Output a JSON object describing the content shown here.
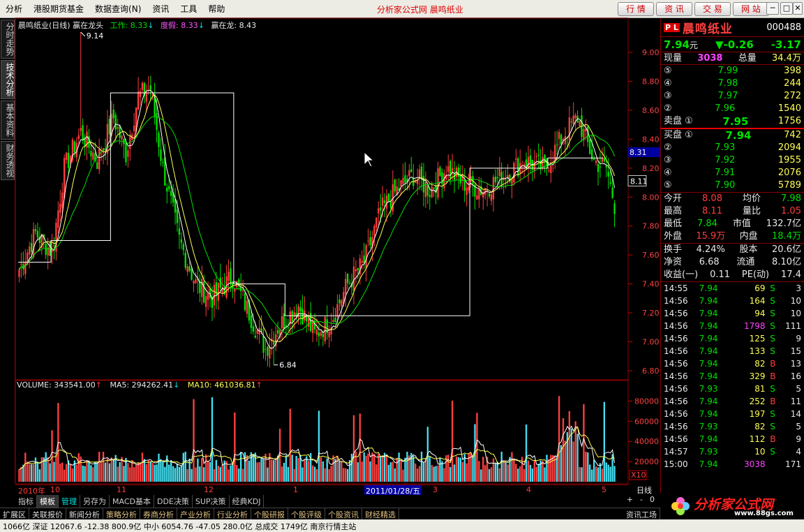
{
  "menu": {
    "items": [
      "分析",
      "港股期货基金",
      "数据查询(N)",
      "资讯",
      "工具",
      "帮助"
    ],
    "center_title": "分析家公式网  晨鸣纸业",
    "quick_buttons": [
      "行 情",
      "资 讯",
      "交 易",
      "网 站"
    ]
  },
  "left_tabs": [
    "分时走势",
    "技术分析",
    "基本资料",
    "财务透视"
  ],
  "kline_header": {
    "title": "晨鸣纸业(日线) 赢在龙头",
    "work_label": "工作: 8.33",
    "dujia_label": "度假: 8.33",
    "yingzailong_label": "赢在龙: 8.43"
  },
  "price_axis": [
    "9.00",
    "8.80",
    "8.60",
    "8.40",
    "8.20",
    "8.00",
    "7.80",
    "7.60",
    "7.40",
    "7.20",
    "7.00",
    "6.80"
  ],
  "price_marker": "8.31",
  "last_marker": "8.11",
  "high_label": "9.14",
  "low_label": "6.84",
  "volume_header": {
    "volume": "VOLUME: 343541.00",
    "ma5": "MA5: 294262.41",
    "ma10": "MA10: 461036.81"
  },
  "volume_axis": [
    "80000",
    "60000",
    "40000",
    "20000"
  ],
  "volume_unit": "X10",
  "date_labels": [
    "2010年",
    "10",
    "11",
    "12",
    "1",
    "2011/01/28/五",
    "3",
    "4",
    "5"
  ],
  "period": "日线",
  "bottom_tabs": [
    "指标",
    "模板",
    "管理",
    "另存为",
    "MACD基本",
    "DDE决策",
    "SUP决策",
    "经典KDJ"
  ],
  "bottom_ctrls": [
    "+",
    "-",
    "0"
  ],
  "sub_tabs": [
    "扩展区",
    "关联报价",
    "新闻分析",
    "策略分析",
    "券商分析",
    "产业分析",
    "行业分析",
    "个股研报",
    "个股评级",
    "个股资讯",
    "财经精选"
  ],
  "sub_right": "资讯工场",
  "status_text": "1066亿  深证 12067.6  -12.38  800.9亿  中小 6054.76  -47.05  280.0亿  总成交 1749亿  南京行情主站",
  "stock": {
    "pl": "P L",
    "name": "晨鸣纸业",
    "code": "000488",
    "price": "7.94",
    "price_unit": "元",
    "change": "▼-0.26",
    "pct": "-3.17",
    "xianliang_label": "现量",
    "xianliang": "3038",
    "zongliang_label": "总量",
    "zongliang": "34.4万"
  },
  "asks": [
    {
      "lvl": "⑤",
      "price": "7.99",
      "vol": "398"
    },
    {
      "lvl": "④",
      "price": "7.98",
      "vol": "244"
    },
    {
      "lvl": "③",
      "price": "7.97",
      "vol": "272"
    },
    {
      "lvl": "②",
      "price": "7.96",
      "vol": "1540"
    },
    {
      "lvl": "卖盘 ①",
      "price": "7.95",
      "vol": "1756"
    }
  ],
  "bids": [
    {
      "lvl": "买盘 ①",
      "price": "7.94",
      "vol": "742"
    },
    {
      "lvl": "②",
      "price": "7.93",
      "vol": "2094"
    },
    {
      "lvl": "③",
      "price": "7.92",
      "vol": "1955"
    },
    {
      "lvl": "④",
      "price": "7.91",
      "vol": "2076"
    },
    {
      "lvl": "⑤",
      "price": "7.90",
      "vol": "5789"
    }
  ],
  "stats": [
    {
      "l1": "今开",
      "v1": "8.08",
      "l2": "均价",
      "v2": "7.98"
    },
    {
      "l1": "最高",
      "v1": "8.11",
      "l2": "量比",
      "v2": "1.05"
    },
    {
      "l1": "最低",
      "v1": "7.84",
      "l2": "市值",
      "v2": "132.7亿"
    },
    {
      "l1": "外盘",
      "v1": "15.9万",
      "l2": "内盘",
      "v2": "18.4万"
    }
  ],
  "fin": [
    {
      "l1": "换手",
      "v1": "4.24%",
      "l2": "股本",
      "v2": "20.6亿"
    },
    {
      "l1": "净资",
      "v1": "6.68",
      "l2": "流通",
      "v2": "8.10亿"
    },
    {
      "l1": "收益(一)",
      "v1": "0.11",
      "l2": "PE(动)",
      "v2": "17.4"
    }
  ],
  "ticks": [
    {
      "t": "14:55",
      "p": "7.94",
      "v": "69",
      "s": "S",
      "n": "3"
    },
    {
      "t": "14:56",
      "p": "7.94",
      "v": "164",
      "s": "S",
      "n": "10"
    },
    {
      "t": "14:56",
      "p": "7.94",
      "v": "94",
      "s": "S",
      "n": "10"
    },
    {
      "t": "14:56",
      "p": "7.94",
      "v": "1798",
      "s": "S",
      "n": "111"
    },
    {
      "t": "14:56",
      "p": "7.94",
      "v": "125",
      "s": "S",
      "n": "9"
    },
    {
      "t": "14:56",
      "p": "7.94",
      "v": "133",
      "s": "S",
      "n": "15"
    },
    {
      "t": "14:56",
      "p": "7.94",
      "v": "82",
      "s": "B",
      "n": "13"
    },
    {
      "t": "14:56",
      "p": "7.94",
      "v": "329",
      "s": "B",
      "n": "16"
    },
    {
      "t": "14:56",
      "p": "7.93",
      "v": "81",
      "s": "S",
      "n": "5"
    },
    {
      "t": "14:56",
      "p": "7.94",
      "v": "252",
      "s": "B",
      "n": "11"
    },
    {
      "t": "14:56",
      "p": "7.94",
      "v": "197",
      "s": "S",
      "n": "14"
    },
    {
      "t": "14:56",
      "p": "7.93",
      "v": "82",
      "s": "S",
      "n": "5"
    },
    {
      "t": "14:56",
      "p": "7.94",
      "v": "112",
      "s": "B",
      "n": "9"
    },
    {
      "t": "14:57",
      "p": "7.93",
      "v": "10",
      "s": "S",
      "n": "4"
    },
    {
      "t": "15:00",
      "p": "7.94",
      "v": "3038",
      "s": "",
      "n": "171"
    }
  ],
  "logo_text": "分析家公式网",
  "logo_url": "www.88gs.com",
  "colors": {
    "up": "#ff3c3c",
    "down": "#00e000",
    "ma5": "#ffffff",
    "ma10": "#ffff55",
    "ma20": "#00e000",
    "step": "#ffffff"
  }
}
